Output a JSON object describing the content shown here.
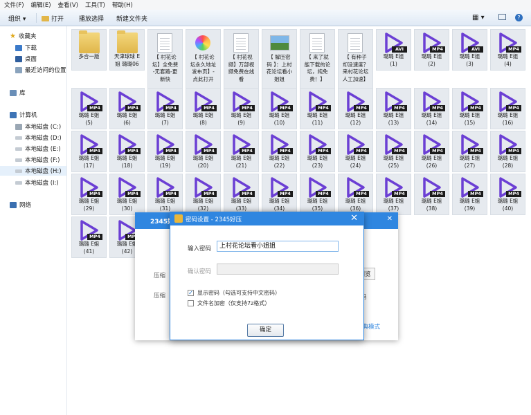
{
  "menu": [
    "文件(F)",
    "编辑(E)",
    "查看(V)",
    "工具(T)",
    "帮助(H)"
  ],
  "toolbar": {
    "organize": "组织 ▾",
    "open": "打开",
    "slideshow": "播放选择",
    "new_folder": "新建文件夹"
  },
  "sidebar": {
    "favorites": "收藏夹",
    "download": "下载",
    "desktop": "桌面",
    "recent": "最近访问的位置",
    "library": "库",
    "computer": "计算机",
    "drives": [
      "本地磁盘 (C:)",
      "本地磁盘 (D:)",
      "本地磁盘 (E:)",
      "本地磁盘 (F:)",
      "本地磁盘 (H:)",
      "本地磁盘 (I:)"
    ],
    "network": "网络"
  },
  "files": [
    {
      "name": "多合一版",
      "kind": "folder"
    },
    {
      "name": "天津球球 E\n姐 璐璐06",
      "kind": "folder"
    },
    {
      "name": "【 村花论\n坛】全免费\n-无套路-更\n新快",
      "kind": "doc"
    },
    {
      "name": "【 村花论\n坛永久地址\n发布页】-\n点此打开",
      "kind": "app"
    },
    {
      "name": "【 村花视\n频】万部视\n频免费在线\n看",
      "kind": "doc"
    },
    {
      "name": "【 解压密\n码 】：上村\n花论坛看小\n姐姐",
      "kind": "image"
    },
    {
      "name": "【 来了就\n能下载的论\n坛，纯免\n费！】",
      "kind": "doc"
    },
    {
      "name": "【 有种子\n却没速度？\n来村花论坛\n人工加速】",
      "kind": "doc"
    },
    {
      "name": "璐璐 E姐\n(1)",
      "kind": "avi"
    },
    {
      "name": "璐璐 E姐\n(2)",
      "kind": "mp4"
    },
    {
      "name": "璐璐 E姐\n(3)",
      "kind": "avi"
    },
    {
      "name": "璐璐 E姐\n(4)",
      "kind": "mp4"
    }
  ],
  "video_names": [
    "(5)",
    "(6)",
    "(7)",
    "(8)",
    "(9)",
    "(10)",
    "(11)",
    "(12)",
    "(13)",
    "(14)",
    "(15)",
    "(16)",
    "(17)",
    "(18)",
    "(19)",
    "(20)",
    "(21)",
    "(22)",
    "(23)",
    "(24)",
    "(25)",
    "(26)",
    "(27)",
    "(28)",
    "(29)",
    "(30)",
    "(31)",
    "(32)",
    "(33)",
    "(34)",
    "(35)",
    "(36)",
    "(37)",
    "(38)",
    "(39)",
    "(40)",
    "(41)",
    "(42)"
  ],
  "video_prefix": "璐璐 E姐",
  "badge": {
    "mp4": "MP4",
    "avi": "AVI"
  },
  "back_dialog": {
    "title": "2345好",
    "compress_label": "压缩",
    "compress_label2": "压缩",
    "browse": "浏览",
    "password_hint": "码",
    "classic_mode": "经典模式"
  },
  "password_dialog": {
    "title": "密码设置 - 2345好压",
    "enter_label": "输入密码",
    "password_value": "上村花论坛看小姐姐",
    "confirm_label": "确认密码",
    "show_password": "显示密码（勾选可支持中文密码）",
    "encrypt_names": "文件名加密（仅支持7z格式）",
    "ok": "确定"
  }
}
